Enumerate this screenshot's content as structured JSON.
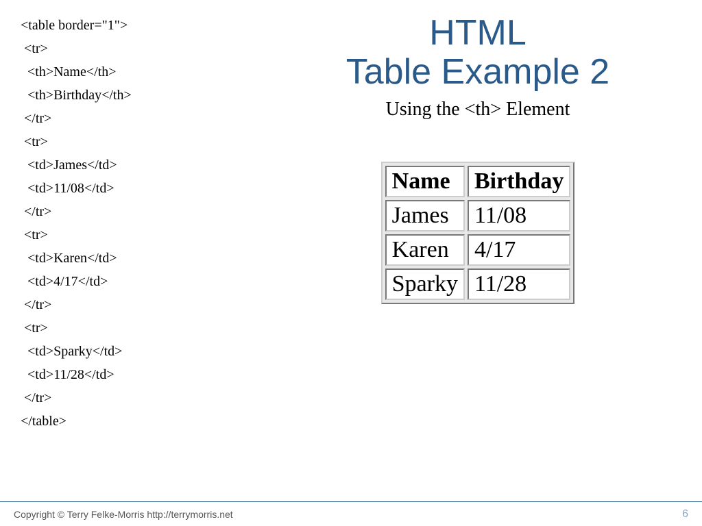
{
  "title_line1": "HTML",
  "title_line2": "Table Example 2",
  "subtitle": "Using the <th> Element",
  "code_lines": [
    "<table border=\"1\">",
    " <tr>",
    "  <th>Name</th>",
    "  <th>Birthday</th>",
    " </tr>",
    " <tr>",
    "  <td>James</td>",
    "  <td>11/08</td>",
    " </tr>",
    " <tr>",
    "  <td>Karen</td>",
    "  <td>4/17</td>",
    " </tr>",
    " <tr>",
    "  <td>Sparky</td>",
    "  <td>11/28</td>",
    " </tr>",
    "</table>"
  ],
  "table": {
    "headers": [
      "Name",
      "Birthday"
    ],
    "rows": [
      [
        "James",
        "11/08"
      ],
      [
        "Karen",
        "4/17"
      ],
      [
        "Sparky",
        "11/28"
      ]
    ]
  },
  "footer": {
    "copyright": "Copyright © Terry Felke-Morris http://terrymorris.net",
    "page": "6"
  }
}
